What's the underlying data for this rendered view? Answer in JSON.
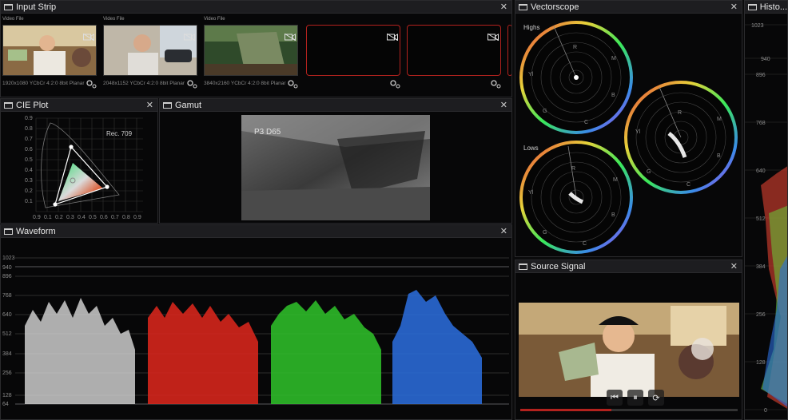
{
  "input_strip": {
    "title": "Input Strip",
    "tiles": [
      {
        "type": "Video File",
        "meta": "1920x1080 YCbCr 4:2:0 8bit Planar"
      },
      {
        "type": "Video File",
        "meta": "2048x1152 YCbCr 4:2:0 8bit Planar"
      },
      {
        "type": "Video File",
        "meta": "3840x2160 YCbCr 4:2:0 8bit Planar"
      }
    ]
  },
  "cie_plot": {
    "title": "CIE Plot",
    "gamut_label": "Rec. 709",
    "y_ticks": [
      "0.9",
      "0.8",
      "0.7",
      "0.6",
      "0.5",
      "0.4",
      "0.3",
      "0.2",
      "0.1"
    ],
    "x_ticks": [
      "0.9",
      "0.1",
      "0.2",
      "0.3",
      "0.4",
      "0.5",
      "0.6",
      "0.7",
      "0.8",
      "0.9"
    ]
  },
  "gamut": {
    "title": "Gamut",
    "overlay": "P3 D65"
  },
  "waveform": {
    "title": "Waveform",
    "levels": [
      "1023",
      "940",
      "896",
      "768",
      "640",
      "512",
      "384",
      "256",
      "128",
      "64"
    ]
  },
  "vectorscope": {
    "title": "Vectorscope",
    "highs": "Highs",
    "lows": "Lows",
    "targets": [
      "R",
      "M",
      "B",
      "C",
      "G",
      "Yl"
    ]
  },
  "source_signal": {
    "title": "Source Signal"
  },
  "histogram": {
    "title": "Histo...",
    "levels": [
      "1023",
      "940",
      "896",
      "768",
      "640",
      "512",
      "384",
      "256",
      "128",
      "0"
    ]
  },
  "colors": {
    "accent_red": "#b3221e",
    "wave_white": "#d8d8d8",
    "wave_red": "#e0271c",
    "wave_green": "#2fc42a",
    "wave_blue": "#2b6fe0"
  }
}
